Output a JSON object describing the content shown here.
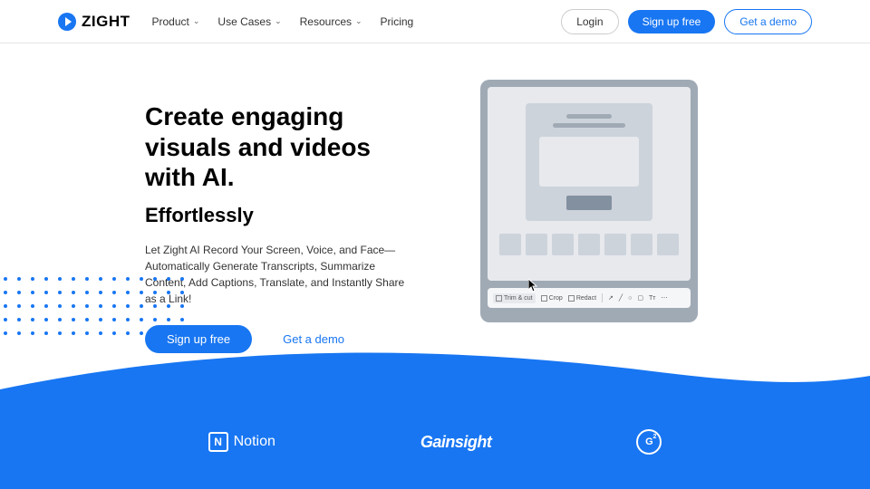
{
  "brand": "ZIGHT",
  "nav": {
    "items": [
      "Product",
      "Use Cases",
      "Resources",
      "Pricing"
    ]
  },
  "header_actions": {
    "login": "Login",
    "signup": "Sign up free",
    "demo": "Get a demo"
  },
  "hero": {
    "title": "Create engaging visuals and videos with AI.",
    "subtitle": "Effortlessly",
    "description": "Let Zight AI Record Your Screen, Voice, and Face—Automatically Generate Transcripts, Summarize Content, Add Captions, Translate, and Instantly Share as a Link!",
    "signup": "Sign up free",
    "demo": "Get a demo"
  },
  "toolbar": {
    "trim": "Trim & cut",
    "crop": "Crop",
    "redact": "Redact"
  },
  "partners": {
    "notion_icon": "N",
    "notion": "Notion",
    "gainsight": "Gainsight",
    "g2": "G",
    "g2_sub": "2"
  }
}
